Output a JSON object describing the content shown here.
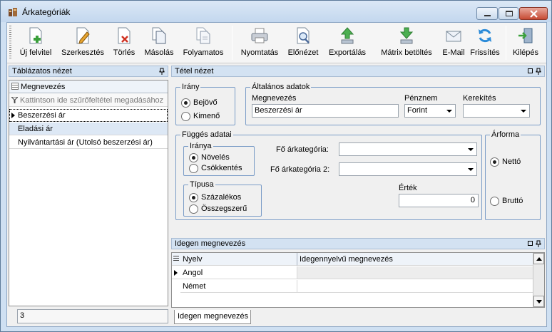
{
  "window": {
    "title": "Árkategóriák"
  },
  "toolbar": {
    "items": [
      {
        "label": "Új felvitel"
      },
      {
        "label": "Szerkesztés"
      },
      {
        "label": "Törlés"
      },
      {
        "label": "Másolás"
      },
      {
        "label": "Folyamatos"
      },
      {
        "label": "Nyomtatás"
      },
      {
        "label": "Előnézet"
      },
      {
        "label": "Exportálás"
      },
      {
        "label": "Mátrix betöltés"
      },
      {
        "label": "E-Mail"
      },
      {
        "label": "Frissítés"
      },
      {
        "label": "Kilépés"
      }
    ]
  },
  "left_panel": {
    "title": "Táblázatos nézet",
    "column_header": "Megnevezés",
    "filter_placeholder": "Kattintson ide szűrőfeltétel megadásához",
    "rows": [
      "Beszerzési ár",
      "Eladási ár",
      "Nyilvántartási ár (Utolsó beszerzési ár)"
    ],
    "record_count": "3"
  },
  "detail": {
    "title": "Tétel nézet",
    "irany": {
      "title": "Irány",
      "options": [
        "Bejövő",
        "Kimenő"
      ],
      "selected": "Bejövő"
    },
    "general": {
      "title": "Általános adatok",
      "name_label": "Megnevezés",
      "name_value": "Beszerzési ár",
      "currency_label": "Pénznem",
      "currency_value": "Forint",
      "rounding_label": "Kerekítés",
      "rounding_value": ""
    },
    "dependency": {
      "title": "Függés adatai",
      "direction_title": "Iránya",
      "direction_options": [
        "Növelés",
        "Csökkentés"
      ],
      "direction_selected": "Növelés",
      "main_cat_label": "Fő árkategória:",
      "main_cat_value": "",
      "main_cat2_label": "Fő árkategória 2:",
      "main_cat2_value": "",
      "type_title": "Típusa",
      "type_options": [
        "Százalékos",
        "Összegszerű"
      ],
      "type_selected": "Százalékos",
      "value_label": "Érték",
      "value": "0"
    },
    "price_form": {
      "title": "Árforma",
      "options": [
        "Nettó",
        "Bruttó"
      ],
      "selected": "Nettó"
    }
  },
  "foreign": {
    "title": "Idegen megnevezés",
    "columns": [
      "Nyelv",
      "Idegennyelvű megnevezés"
    ],
    "rows": [
      {
        "lang": "Angol",
        "name": ""
      },
      {
        "lang": "Német",
        "name": ""
      }
    ],
    "tab_label": "Idegen megnevezés"
  }
}
